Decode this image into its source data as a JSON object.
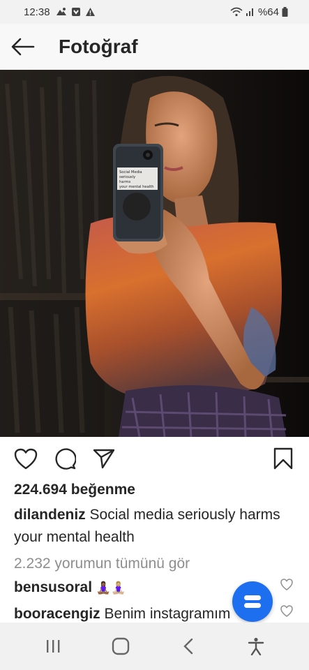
{
  "status_bar": {
    "time": "12:38",
    "battery": "%64",
    "icons": [
      "teams-icon",
      "download-icon",
      "warning-icon",
      "wifi-icon",
      "signal-icon",
      "battery-icon"
    ]
  },
  "header": {
    "title": "Fotoğraf",
    "back_icon": "arrow-left-icon"
  },
  "photo": {
    "phone_sticker_text": [
      "Social Media",
      "seriously",
      "harms",
      "your mental health"
    ]
  },
  "actions": {
    "icons": [
      "heart-icon",
      "comment-icon",
      "share-icon",
      "bookmark-icon"
    ]
  },
  "post": {
    "likes": "224.694 beğenme",
    "author": "dilandeniz",
    "caption": "Social media seriously harms your mental health",
    "view_comments": "2.232 yorumun tümünü gör"
  },
  "comments": [
    {
      "user": "bensusoral",
      "text": "🧘🏾‍♀️🧘🏼‍♀️"
    },
    {
      "user": "booracengiz",
      "text": "Benim instagramım"
    }
  ],
  "fab": {
    "icon": "equals-icon",
    "color": "#1e6ef0"
  },
  "nav_bar": {
    "icons": [
      "recent-apps-icon",
      "home-icon",
      "back-icon",
      "accessibility-icon"
    ]
  }
}
